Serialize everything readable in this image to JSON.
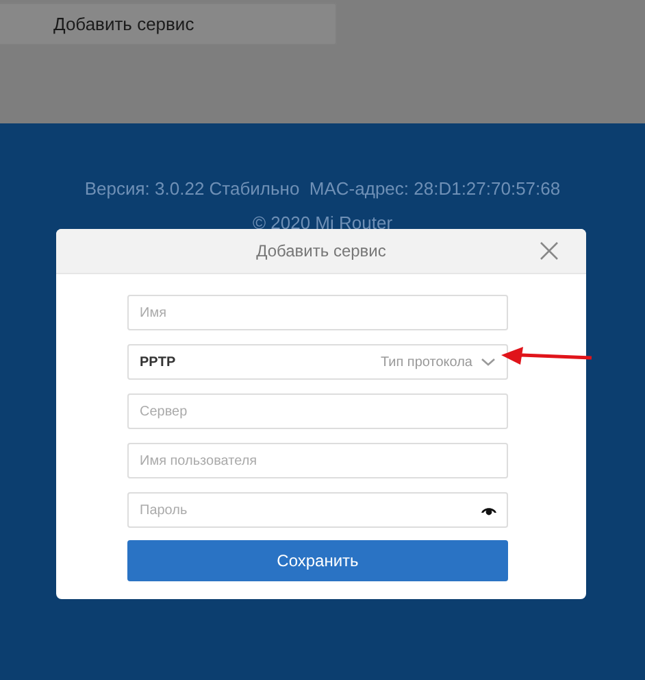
{
  "page": {
    "add_service_button": "Добавить сервис",
    "footer": [
      "Версия: 3.0.22 Стабильно  MAC-адрес: 28:D1:27:70:57:68",
      "© 2020 Mi Router"
    ]
  },
  "dialog": {
    "title": "Добавить сервис",
    "fields": [
      {
        "kind": "text",
        "placeholder": "Имя"
      },
      {
        "kind": "select",
        "value": "PPTP",
        "hint": "Тип протокола"
      },
      {
        "kind": "text",
        "placeholder": "Сервер"
      },
      {
        "kind": "text",
        "placeholder": "Имя пользователя"
      },
      {
        "kind": "password",
        "placeholder": "Пароль"
      }
    ],
    "save_button": "Сохранить"
  }
}
